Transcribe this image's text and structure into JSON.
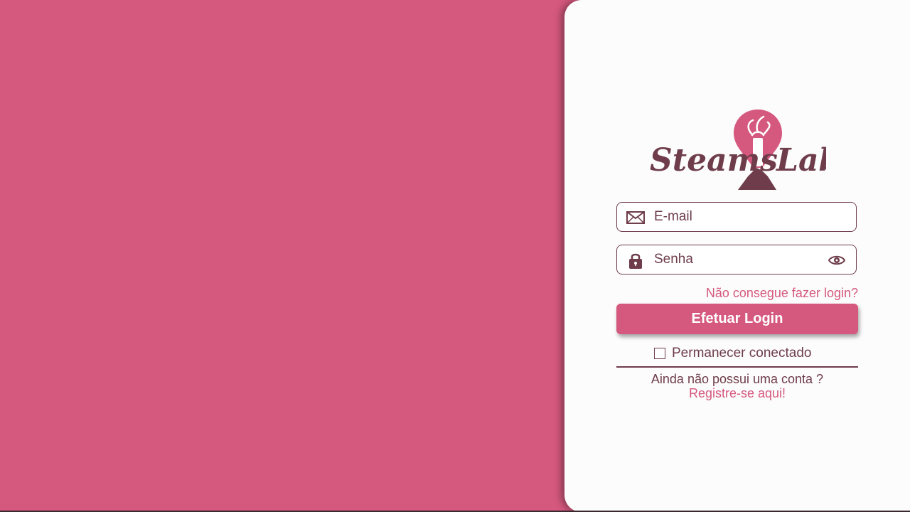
{
  "colors": {
    "background": "#d5587e",
    "panel": "#fcfcfc",
    "accent": "#d5587e",
    "dark": "#6e3c4b"
  },
  "logo": {
    "text_left": "Steams",
    "text_right": "Lab"
  },
  "form": {
    "email": {
      "placeholder": "E-mail",
      "value": "",
      "icon": "envelope-icon"
    },
    "password": {
      "placeholder": "Senha",
      "value": "",
      "icon": "lock-icon",
      "toggle_icon": "eye-icon"
    },
    "forgot_link": "Não consegue fazer login?",
    "login_button": "Efetuar Login",
    "remember_label": "Permanecer conectado",
    "remember_checked": false
  },
  "footer": {
    "no_account_text": "Ainda não possui uma conta ?",
    "register_link": "Registre-se aqui!"
  }
}
